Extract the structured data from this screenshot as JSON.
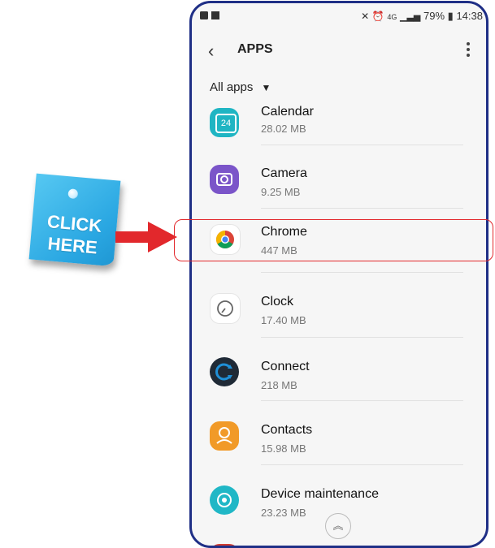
{
  "annotation": {
    "sticky_text_line1": "CLICK",
    "sticky_text_line2": "HERE",
    "accent_color": "#e2282c",
    "arrow_color": "#e2282c"
  },
  "status_bar": {
    "battery": "79%",
    "time": "14:38",
    "network": "4G"
  },
  "app_bar": {
    "title": "APPS",
    "back_icon": "chevron-left-icon",
    "menu_icon": "more-vert-icon"
  },
  "filter": {
    "label": "All apps"
  },
  "apps": [
    {
      "name": "Calendar",
      "size": "28.02 MB",
      "icon": "calendar-icon",
      "color": "#1fb5c3",
      "day": "24"
    },
    {
      "name": "Camera",
      "size": "9.25 MB",
      "icon": "camera-icon",
      "color": "#7b55c9"
    },
    {
      "name": "Chrome",
      "size": "447 MB",
      "icon": "chrome-icon"
    },
    {
      "name": "Clock",
      "size": "17.40 MB",
      "icon": "clock-icon"
    },
    {
      "name": "Connect",
      "size": "218 MB",
      "icon": "connect-icon",
      "color": "#1f2a36"
    },
    {
      "name": "Contacts",
      "size": "15.98 MB",
      "icon": "contacts-icon",
      "color": "#f19a28"
    },
    {
      "name": "Device maintenance",
      "size": "23.23 MB",
      "icon": "device-maintenance-icon",
      "color": "#20b7c6"
    }
  ]
}
